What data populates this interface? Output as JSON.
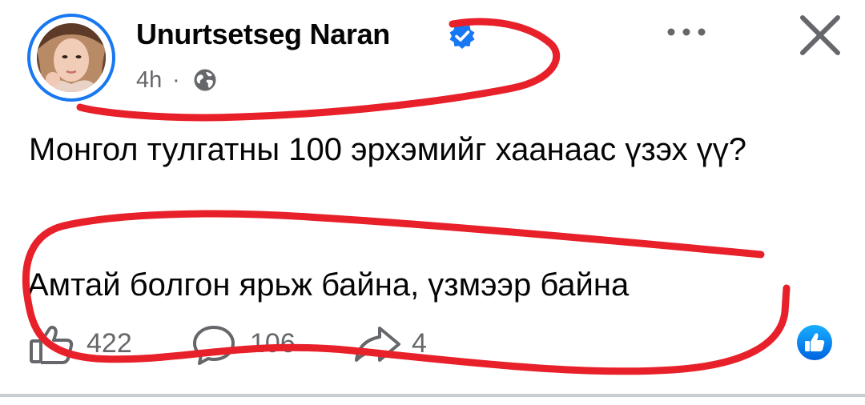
{
  "post": {
    "author_name": "Unurtsetseg Naran",
    "time": "4h",
    "separator": "·",
    "text_line1": "Монгол тулгатны 100 эрхэмийг хаанаас үзэх үү?",
    "text_line2": "Амтай болгон ярьж байна, үзмээр байна"
  },
  "actions": {
    "likes": "422",
    "comments": "106",
    "shares": "4"
  },
  "icons": {
    "verified": "verified-badge-icon",
    "privacy": "globe-icon",
    "more": "more-dots-icon",
    "close": "close-icon",
    "like": "thumbs-up-icon",
    "comment": "comment-bubble-icon",
    "share": "share-arrow-icon",
    "reaction": "like-reaction-icon"
  },
  "colors": {
    "accent": "#1877f2",
    "secondary_text": "#65676b",
    "annotation": "#e8202a"
  }
}
